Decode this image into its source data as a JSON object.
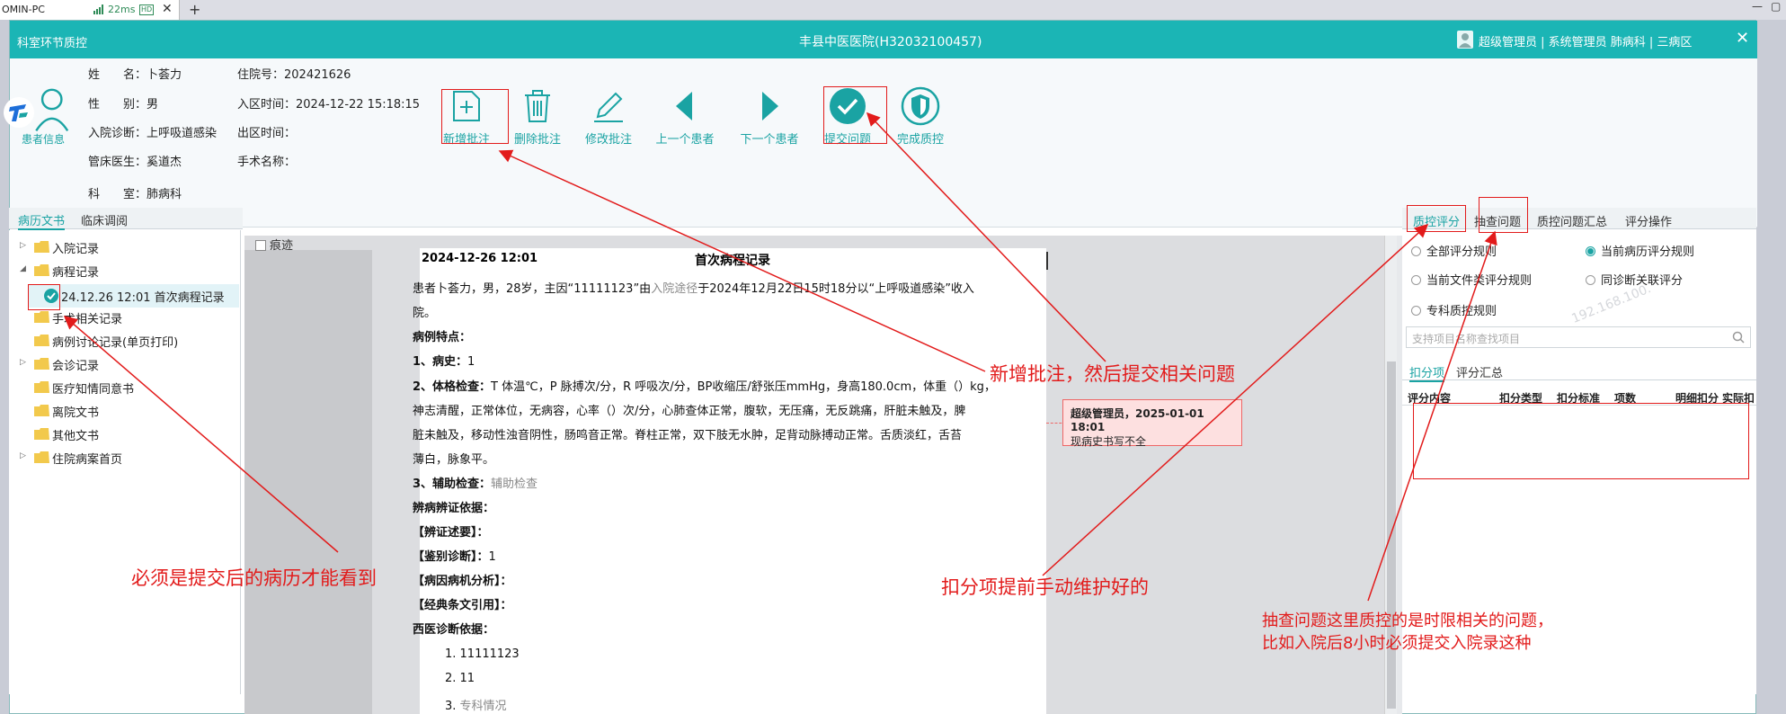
{
  "browser": {
    "tab_title": "OMIN-PC",
    "ping": "22ms",
    "hd": "HD",
    "tab_close": "✕",
    "new_tab": "+"
  },
  "window": {
    "left_title": "科室环节质控",
    "center_title": "丰县中医医院(H32032100457)",
    "user_info": "超级管理员 | 系统管理员   肺病科 | 三病区",
    "close": "✕"
  },
  "patient": {
    "section_label": "患者信息",
    "name": "姓　　名：卜荟力",
    "gender": "性　　别：男",
    "admit_diag": "入院诊断：上呼吸道感染",
    "doctor": "管床医生：奚道杰",
    "dept": "科　　室：肺病科",
    "inpatient_no": "住院号：202421626",
    "admit_time": "入区时间：2024-12-22 15:18:15",
    "discharge_time": "出区时间：",
    "surgery": "手术名称："
  },
  "toolbar": {
    "new_annotation": "新增批注",
    "delete_annotation": "删除批注",
    "edit_annotation": "修改批注",
    "prev_patient": "上一个患者",
    "next_patient": "下一个患者",
    "submit_issue": "提交问题",
    "complete_qc": "完成质控"
  },
  "left_tabs": [
    "病历文书",
    "临床调阅"
  ],
  "tree": [
    {
      "label": "入院记录"
    },
    {
      "label": "病程记录"
    },
    {
      "label": "24.12.26 12:01 首次病程记录"
    },
    {
      "label": "手术相关记录"
    },
    {
      "label": "病例讨论记录(单页打印)"
    },
    {
      "label": "会诊记录"
    },
    {
      "label": "医疗知情同意书"
    },
    {
      "label": "离院文书"
    },
    {
      "label": "其他文书"
    },
    {
      "label": "住院病案首页"
    }
  ],
  "document": {
    "trace_label": "痕迹",
    "date": "2024-12-26 12:01",
    "title": "首次病程记录",
    "l1a": "患者卜荟力，男，28岁，主因“11111123”由",
    "l1b": "入院途径",
    "l1c": "于2024年12月22日15时18分以“上呼吸道感染”收入",
    "l2": "院。",
    "l3": "病例特点：",
    "l4a": "1、病史：",
    "l4b": "1",
    "l5a": "2、体格检查：",
    "l5b": "T 体温℃，P 脉搏次/分，R 呼吸次/分，BP收缩压/舒张压mmHg，身高180.0cm，体重（）kg，",
    "l6": "神志清醒，正常体位，无病容，心率（）次/分，心肺查体正常，腹软，无压痛，无反跳痛，肝脏未触及，脾",
    "l7": "脏未触及，移动性浊音阴性，肠鸣音正常。脊柱正常，双下肢无水肿，足背动脉搏动正常。舌质淡红，舌苔",
    "l8": "薄白，脉象平。",
    "l9a": "3、辅助检查：",
    "l9b": "辅助检查",
    "l10": "辨病辨证依据：",
    "l11": "【辨证述要】：",
    "l12a": "【鉴别诊断】：",
    "l12b": "1",
    "l13": "【病因病机分析】：",
    "l14": "【经典条文引用】：",
    "l15": "西医诊断依据：",
    "l16": "1. 11111123",
    "l17": "2. 11",
    "l18a": "3. ",
    "l18b": "专科情况",
    "annotation_author": "超级管理员，2025-01-01 18:01",
    "annotation_text": "现病史书写不全"
  },
  "right_tabs": [
    "质控评分",
    "抽查问题",
    "质控问题汇总",
    "评分操作"
  ],
  "rules": {
    "all": "全部评分规则",
    "current_record": "当前病历评分规则",
    "current_file_type": "当前文件类评分规则",
    "sync_diag": "同诊断关联评分",
    "specialty": "专科质控规则"
  },
  "search": {
    "placeholder": "支持项目名称查找项目"
  },
  "sub_tabs": [
    "扣分项",
    "评分汇总"
  ],
  "table_headers": [
    "评分内容",
    "扣分类型",
    "扣分标准",
    "项数",
    "明细扣分",
    "实际扣"
  ],
  "watermark": "192.168.100.",
  "callouts": {
    "add_then_submit": "新增批注，然后提交相关问题",
    "must_submit": "必须是提交后的病历才能看到",
    "maintained": "扣分项提前手动维护好的",
    "spot_check_1": "抽查问题这里质控的是时限相关的问题，",
    "spot_check_2": "比如入院后8小时必须提交入院录这种"
  },
  "colors": {
    "teal": "#1bb5b5",
    "accent": "#1aa3a3",
    "annotation_red": "#e21b1b"
  }
}
